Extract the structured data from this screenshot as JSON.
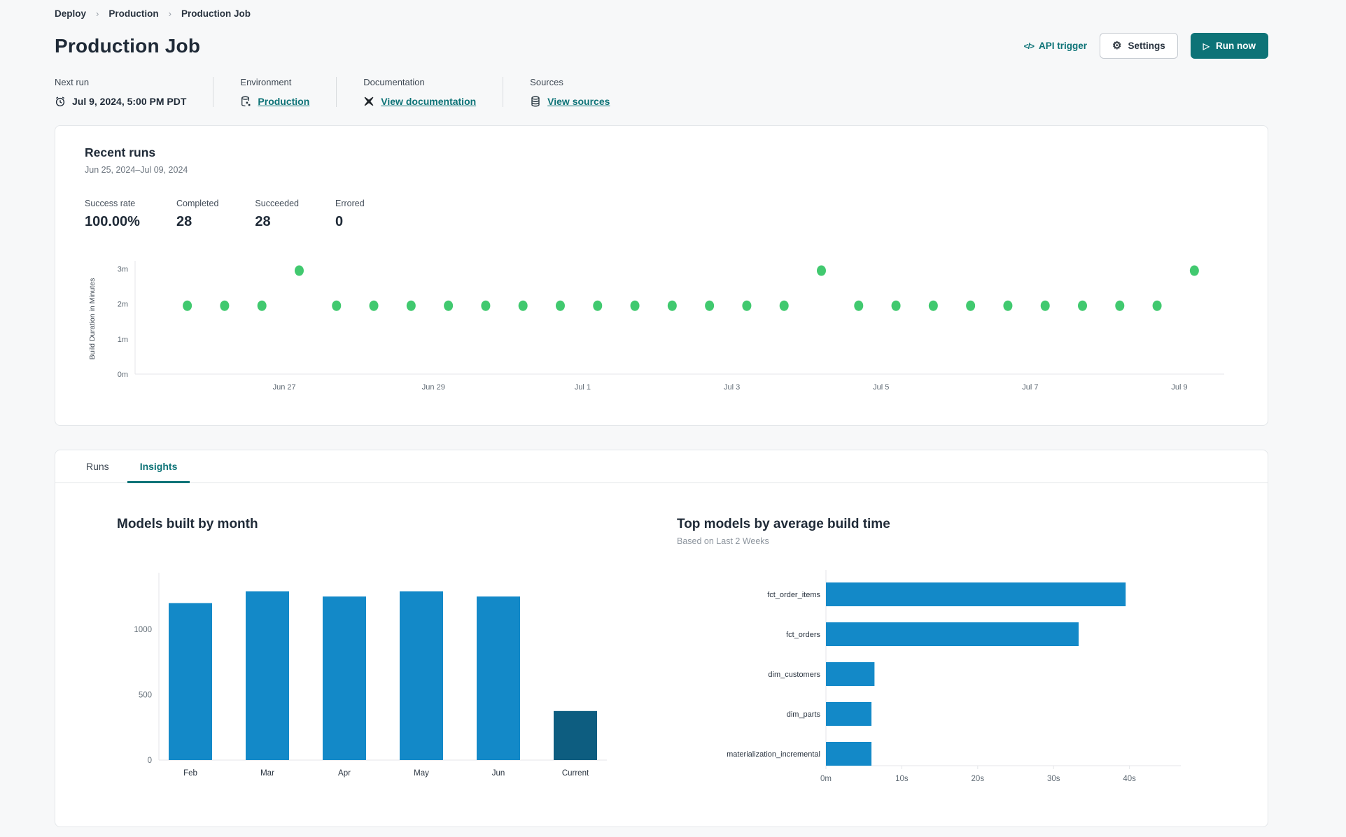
{
  "colors": {
    "accent_teal": "#0d7377",
    "bar_blue": "#1389c8",
    "bar_dark_blue": "#0d5d80",
    "dot_green": "#41c96f",
    "axis_line": "#e4e6e9",
    "tick_text": "#5f6a74"
  },
  "breadcrumb": {
    "items": [
      {
        "label": "Deploy"
      },
      {
        "label": "Production"
      },
      {
        "label": "Production Job"
      }
    ]
  },
  "header": {
    "title": "Production Job",
    "api_trigger_label": "API trigger",
    "settings_label": "Settings",
    "run_now_label": "Run now"
  },
  "info": {
    "next_run": {
      "label": "Next run",
      "value": "Jul 9, 2024, 5:00 PM PDT"
    },
    "environment": {
      "label": "Environment",
      "link": "Production"
    },
    "documentation": {
      "label": "Documentation",
      "link": "View documentation"
    },
    "sources": {
      "label": "Sources",
      "link": "View sources"
    }
  },
  "recent_runs": {
    "title": "Recent runs",
    "date_range": "Jun 25, 2024–Jul 09, 2024",
    "stats": [
      {
        "label": "Success rate",
        "value": "100.00%"
      },
      {
        "label": "Completed",
        "value": "28"
      },
      {
        "label": "Succeeded",
        "value": "28"
      },
      {
        "label": "Errored",
        "value": "0"
      }
    ]
  },
  "tabs": [
    {
      "label": "Runs",
      "active": false
    },
    {
      "label": "Insights",
      "active": true
    }
  ],
  "chart_data": [
    {
      "id": "run_build_durations",
      "type": "scatter",
      "title": "Recent runs build durations",
      "ylabel": "Build Duration in Minutes",
      "xlim": [
        0,
        14.6
      ],
      "ylim": [
        0,
        3.15
      ],
      "grid": false,
      "yticks": [
        {
          "value": 0,
          "label": "0m"
        },
        {
          "value": 1,
          "label": "1m"
        },
        {
          "value": 2,
          "label": "2m"
        },
        {
          "value": 3,
          "label": "3m"
        }
      ],
      "xticks": [
        {
          "day": 2,
          "label": "Jun 27"
        },
        {
          "day": 4,
          "label": "Jun 29"
        },
        {
          "day": 6,
          "label": "Jul 1"
        },
        {
          "day": 8,
          "label": "Jul 3"
        },
        {
          "day": 10,
          "label": "Jul 5"
        },
        {
          "day": 12,
          "label": "Jul 7"
        },
        {
          "day": 14,
          "label": "Jul 9"
        }
      ],
      "points": [
        {
          "day": 0.7,
          "minutes": 1.95
        },
        {
          "day": 1.2,
          "minutes": 1.95
        },
        {
          "day": 1.7,
          "minutes": 1.95
        },
        {
          "day": 2.2,
          "minutes": 2.95
        },
        {
          "day": 2.7,
          "minutes": 1.95
        },
        {
          "day": 3.2,
          "minutes": 1.95
        },
        {
          "day": 3.7,
          "minutes": 1.95
        },
        {
          "day": 4.2,
          "minutes": 1.95
        },
        {
          "day": 4.7,
          "minutes": 1.95
        },
        {
          "day": 5.2,
          "minutes": 1.95
        },
        {
          "day": 5.7,
          "minutes": 1.95
        },
        {
          "day": 6.2,
          "minutes": 1.95
        },
        {
          "day": 6.7,
          "minutes": 1.95
        },
        {
          "day": 7.2,
          "minutes": 1.95
        },
        {
          "day": 7.7,
          "minutes": 1.95
        },
        {
          "day": 8.2,
          "minutes": 1.95
        },
        {
          "day": 8.7,
          "minutes": 1.95
        },
        {
          "day": 9.2,
          "minutes": 2.95
        },
        {
          "day": 9.7,
          "minutes": 1.95
        },
        {
          "day": 10.2,
          "minutes": 1.95
        },
        {
          "day": 10.7,
          "minutes": 1.95
        },
        {
          "day": 11.2,
          "minutes": 1.95
        },
        {
          "day": 11.7,
          "minutes": 1.95
        },
        {
          "day": 12.2,
          "minutes": 1.95
        },
        {
          "day": 12.7,
          "minutes": 1.95
        },
        {
          "day": 13.2,
          "minutes": 1.95
        },
        {
          "day": 13.7,
          "minutes": 1.95
        },
        {
          "day": 14.2,
          "minutes": 2.95
        }
      ]
    },
    {
      "id": "models_built_by_month",
      "type": "bar",
      "title": "Models built by month",
      "categories": [
        "Feb",
        "Mar",
        "Apr",
        "May",
        "Jun",
        "Current"
      ],
      "values": [
        1200,
        1290,
        1250,
        1290,
        1250,
        375
      ],
      "ylim": [
        0,
        1400
      ],
      "yticks": [
        0,
        500,
        1000
      ],
      "highlight_last": true
    },
    {
      "id": "top_models_by_average_build_time",
      "type": "bar-horizontal",
      "title": "Top models by average build time",
      "subtitle": "Based on Last 2 Weeks",
      "categories": [
        "fct_order_items",
        "fct_orders",
        "dim_customers",
        "dim_parts",
        "materialization_incremental"
      ],
      "values_seconds": [
        39.5,
        33.3,
        6.4,
        6.0,
        6.0
      ],
      "xlim": [
        0,
        44
      ],
      "xticks": [
        {
          "value": 0,
          "label": "0m"
        },
        {
          "value": 10,
          "label": "10s"
        },
        {
          "value": 20,
          "label": "20s"
        },
        {
          "value": 30,
          "label": "30s"
        },
        {
          "value": 40,
          "label": "40s"
        }
      ]
    }
  ]
}
